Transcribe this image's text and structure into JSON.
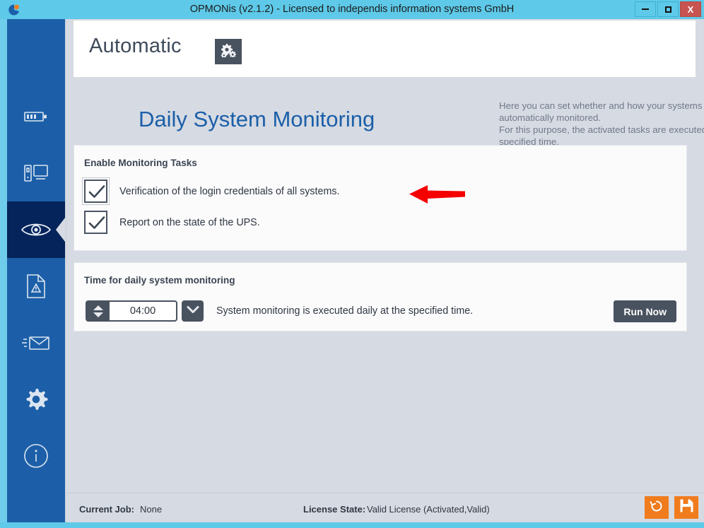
{
  "window": {
    "title": "OPMONis (v2.1.2) - Licensed to independis information systems GmbH",
    "app_icon": "opmonis-logo-icon",
    "controls": {
      "minimize": "minimize-icon",
      "maximize": "maximize-icon",
      "close": "X"
    }
  },
  "sidebar": {
    "items": [
      {
        "name": "battery",
        "icon": "battery-icon",
        "selected": false
      },
      {
        "name": "systems",
        "icon": "computer-monitor-icon",
        "selected": false
      },
      {
        "name": "monitoring",
        "icon": "eye-icon",
        "selected": true
      },
      {
        "name": "reports",
        "icon": "document-warning-icon",
        "selected": false
      },
      {
        "name": "mail",
        "icon": "envelope-icon",
        "selected": false
      },
      {
        "name": "settings",
        "icon": "gear-icon",
        "selected": false
      },
      {
        "name": "info",
        "icon": "info-circle-icon",
        "selected": false
      }
    ]
  },
  "header": {
    "title": "Automatic",
    "gears_button_icon": "gears-icon"
  },
  "page": {
    "section_title": "Daily System Monitoring",
    "description": "Here you can set whether and how your systems are automatically monitored.\nFor this purpose, the activated tasks are executed daily at the specified time."
  },
  "tasks_panel": {
    "heading": "Enable Monitoring Tasks",
    "tasks": [
      {
        "label": "Verification of the login credentials of all systems.",
        "checked": true,
        "focused": true
      },
      {
        "label": "Report on the state of the UPS.",
        "checked": true,
        "focused": false
      }
    ]
  },
  "time_panel": {
    "heading": "Time for daily system monitoring",
    "time_value": "04:00",
    "note": "System monitoring is executed daily at the specified time.",
    "run_now_label": "Run Now",
    "spinner_up_icon": "chevron-up-icon",
    "spinner_down_icon": "chevron-down-icon",
    "dropdown_icon": "chevron-down-icon"
  },
  "annotation": {
    "arrow": "red-left-arrow",
    "color": "#f50000"
  },
  "statusbar": {
    "current_job_label": "Current Job:",
    "current_job_value": "None",
    "license_label": "License State:",
    "license_value": "Valid License (Activated,Valid)",
    "actions": [
      {
        "name": "undo",
        "icon": "undo-arrow-icon"
      },
      {
        "name": "save",
        "icon": "floppy-disk-save-icon"
      }
    ]
  },
  "colors": {
    "titlebar": "#5ec9e8",
    "sidebar": "#1c5fa8",
    "sidebar_selected": "#04245b",
    "accent_blue": "#1b5fa9",
    "content_bg": "#d6dae2",
    "dark_button": "#49525f",
    "orange": "#f07c1e",
    "close_red": "#c75450"
  }
}
